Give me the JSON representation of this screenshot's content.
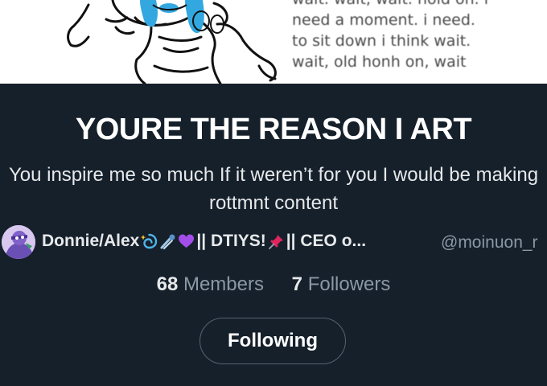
{
  "banner": {
    "lines": [
      "wait. wait, wait. hold on. i",
      "need a moment. i need.",
      "to sit down i think wait.",
      "wait, old honh on, wait"
    ]
  },
  "community": {
    "title": "YOURE THE REASON I ART",
    "description": "You inspire me so much If it weren’t for you I would be making rottmnt content"
  },
  "owner": {
    "name_part1": "Donnie/Alex",
    "name_part2": "|| DTIYS!",
    "name_part3": "|| CEO o...",
    "handle": "@moinuon_r",
    "emoji_icons": [
      "dizzy-icon",
      "comet-icon",
      "purple-heart-icon",
      "pushpin-icon"
    ]
  },
  "stats": {
    "members_count": "68",
    "members_label": "Members",
    "followers_count": "7",
    "followers_label": "Followers"
  },
  "actions": {
    "following_label": "Following"
  },
  "colors": {
    "background": "#15202b",
    "text_primary": "#e7e9ea",
    "text_secondary": "#8b98a5",
    "button_border": "#536471",
    "heart": "#a34ee8",
    "pin": "#e0245e"
  }
}
